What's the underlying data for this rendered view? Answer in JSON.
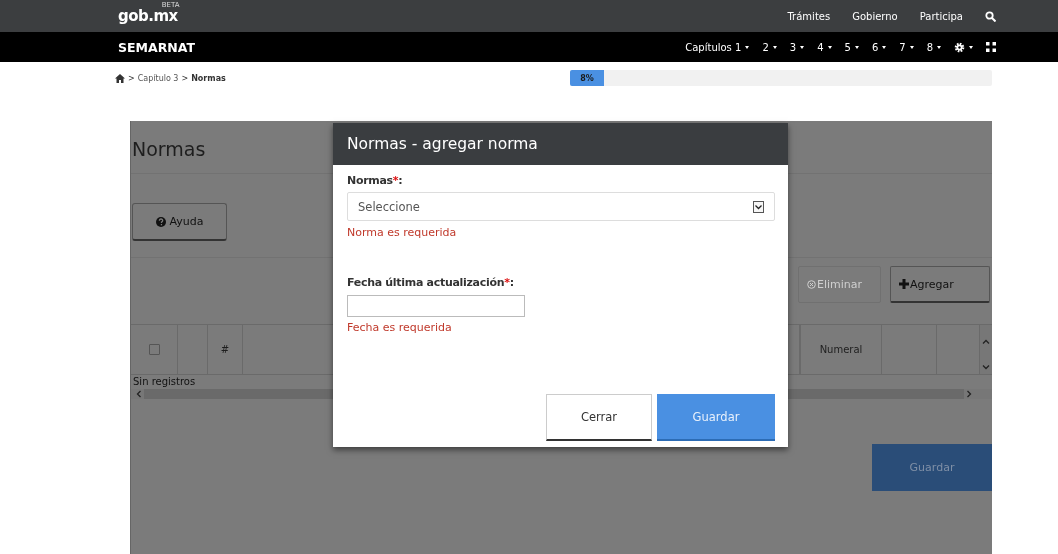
{
  "top_bar": {
    "logo": "gob.mx",
    "logo_badge": "BETA",
    "links": [
      "Trámites",
      "Gobierno",
      "Participa"
    ]
  },
  "nav_bar": {
    "title": "SEMARNAT",
    "menus": [
      {
        "label": "Capítulos 1",
        "kind": "text"
      },
      {
        "label": "2",
        "kind": "text"
      },
      {
        "label": "3",
        "kind": "text"
      },
      {
        "label": "4",
        "kind": "text"
      },
      {
        "label": "5",
        "kind": "text"
      },
      {
        "label": "6",
        "kind": "text"
      },
      {
        "label": "7",
        "kind": "text"
      },
      {
        "label": "8",
        "kind": "text"
      },
      {
        "kind": "gear"
      }
    ]
  },
  "breadcrumb": [
    {
      "kind": "home"
    },
    {
      "kind": "sep",
      "text": ">"
    },
    {
      "kind": "link",
      "text": "Capítulo 3"
    },
    {
      "kind": "sep",
      "text": ">"
    },
    {
      "kind": "current",
      "text": "Normas"
    }
  ],
  "progress": {
    "label": "8%",
    "level": 0.08
  },
  "page": {
    "title": "Normas",
    "help_button": "Ayuda",
    "toolbar": [
      {
        "label": "Eliminar",
        "kind": "delete",
        "disabled": true
      },
      {
        "label": "Agregar",
        "kind": "add",
        "disabled": false
      }
    ],
    "table": {
      "header_checked": false,
      "columns_left": [
        {
          "kind": "blank"
        },
        {
          "kind": "label",
          "label": "#"
        }
      ],
      "columns_right": [
        {
          "kind": "label",
          "label": "Numeral"
        },
        {
          "kind": "blank"
        },
        {
          "kind": "blank"
        }
      ],
      "empty_text": "Sin registros"
    },
    "save_button": "Guardar"
  },
  "modal": {
    "title": "Normas - agregar norma",
    "fields": [
      {
        "kind": "select",
        "label": "Normas",
        "required_mark": "*",
        "suffix": ":",
        "placeholder": "Seleccione",
        "error": "Norma es requerida"
      },
      {
        "kind": "text",
        "label": "Fecha última actualización",
        "required_mark": "*",
        "suffix": ":",
        "error": "Fecha es requerida"
      }
    ],
    "buttons": [
      {
        "label": "Cerrar",
        "kind": "default"
      },
      {
        "label": "Guardar",
        "kind": "primary"
      }
    ]
  }
}
